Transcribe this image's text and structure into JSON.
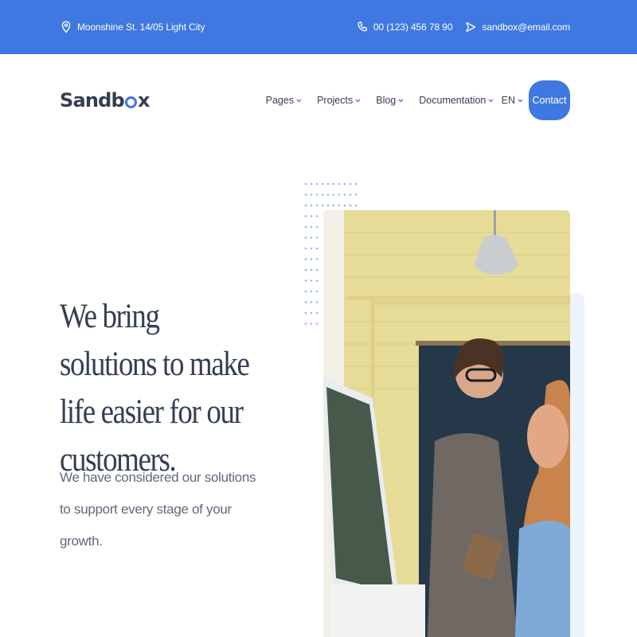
{
  "topbar": {
    "address": "Moonshine St. 14/05 Light City",
    "phone": "00 (123) 456 78 90",
    "email": "sandbox@email.com",
    "icons": [
      "map-pin-icon",
      "phone-icon",
      "send-icon"
    ]
  },
  "navbar": {
    "logo": {
      "part1": "Sandb",
      "part2": "x"
    },
    "links": [
      {
        "label": "Pages"
      },
      {
        "label": "Projects"
      },
      {
        "label": "Blog"
      },
      {
        "label": "Documentation"
      }
    ],
    "language": "EN",
    "contact_label": "Contact"
  },
  "hero": {
    "title": "We bring solutions to make life easier for our customers.",
    "subtitle": "We have considered our solutions to support every stage of your growth."
  },
  "colors": {
    "accent": "#3f78e0",
    "text_dark": "#343f52",
    "text_muted": "#60697b",
    "soft_bg": "#eef3fc"
  }
}
